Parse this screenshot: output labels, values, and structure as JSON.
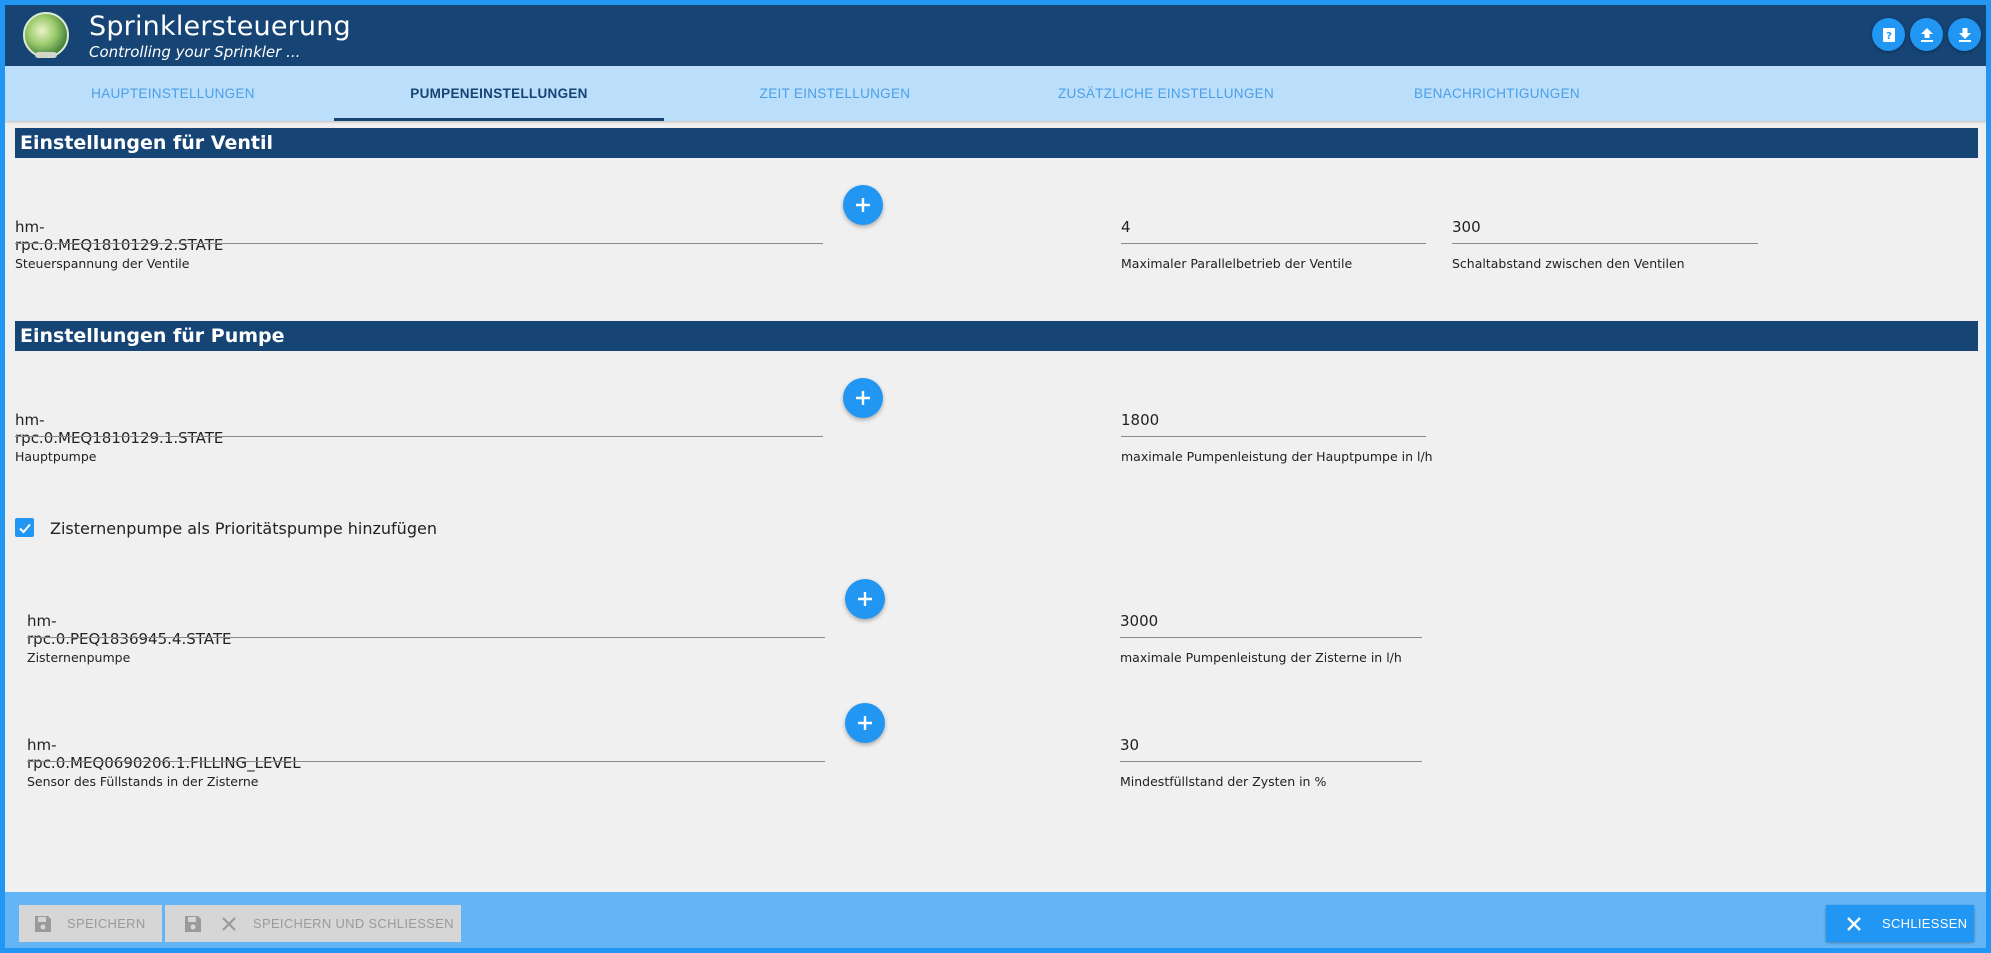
{
  "header": {
    "title": "Sprinklersteuerung",
    "subtitle": "Controlling your Sprinkler ..."
  },
  "tabs": [
    {
      "label": "Haupteinstellungen",
      "active": false
    },
    {
      "label": "Pumpeneinstellungen",
      "active": true
    },
    {
      "label": "Zeit Einstellungen",
      "active": false
    },
    {
      "label": "Zusätzliche Einstellungen",
      "active": false
    },
    {
      "label": "Benachrichtigungen",
      "active": false
    }
  ],
  "ventil": {
    "heading": "Einstellungen für Ventil",
    "control_voltage": {
      "value": "hm-rpc.0.MEQ1810129.2.STATE",
      "label": "Steuerspannung der Ventile"
    },
    "max_parallel": {
      "value": "4",
      "label": "Maximaler Parallelbetrieb der Ventile"
    },
    "switch_interval": {
      "value": "300",
      "label": "Schaltabstand zwischen den Ventilen"
    }
  },
  "pumpe": {
    "heading": "Einstellungen für Pumpe",
    "main_pump": {
      "value": "hm-rpc.0.MEQ1810129.1.STATE",
      "label": "Hauptpumpe"
    },
    "main_pump_capacity": {
      "value": "1800",
      "label": "maximale Pumpenleistung der Hauptpumpe in l/h"
    },
    "cistern_checkbox": {
      "label": "Zisternenpumpe als Prioritätspumpe hinzufügen",
      "checked": true
    },
    "cistern_pump": {
      "value": "hm-rpc.0.PEQ1836945.4.STATE",
      "label": "Zisternenpumpe"
    },
    "cistern_capacity": {
      "value": "3000",
      "label": "maximale Pumpenleistung der Zisterne in l/h"
    },
    "level_sensor": {
      "value": "hm-rpc.0.MEQ0690206.1.FILLING_LEVEL",
      "label": "Sensor des Füllstands in der Zisterne"
    },
    "min_level": {
      "value": "30",
      "label": "Mindestfüllstand der Zysten in %"
    }
  },
  "footer": {
    "save_label": "Speichern",
    "save_close_label": "Speichern und schliessen",
    "close_label": "Schliessen"
  },
  "colors": {
    "primary": "#164475",
    "accent": "#2196f3",
    "tab_bar": "#bbdefb",
    "footer": "#64b5f6"
  }
}
